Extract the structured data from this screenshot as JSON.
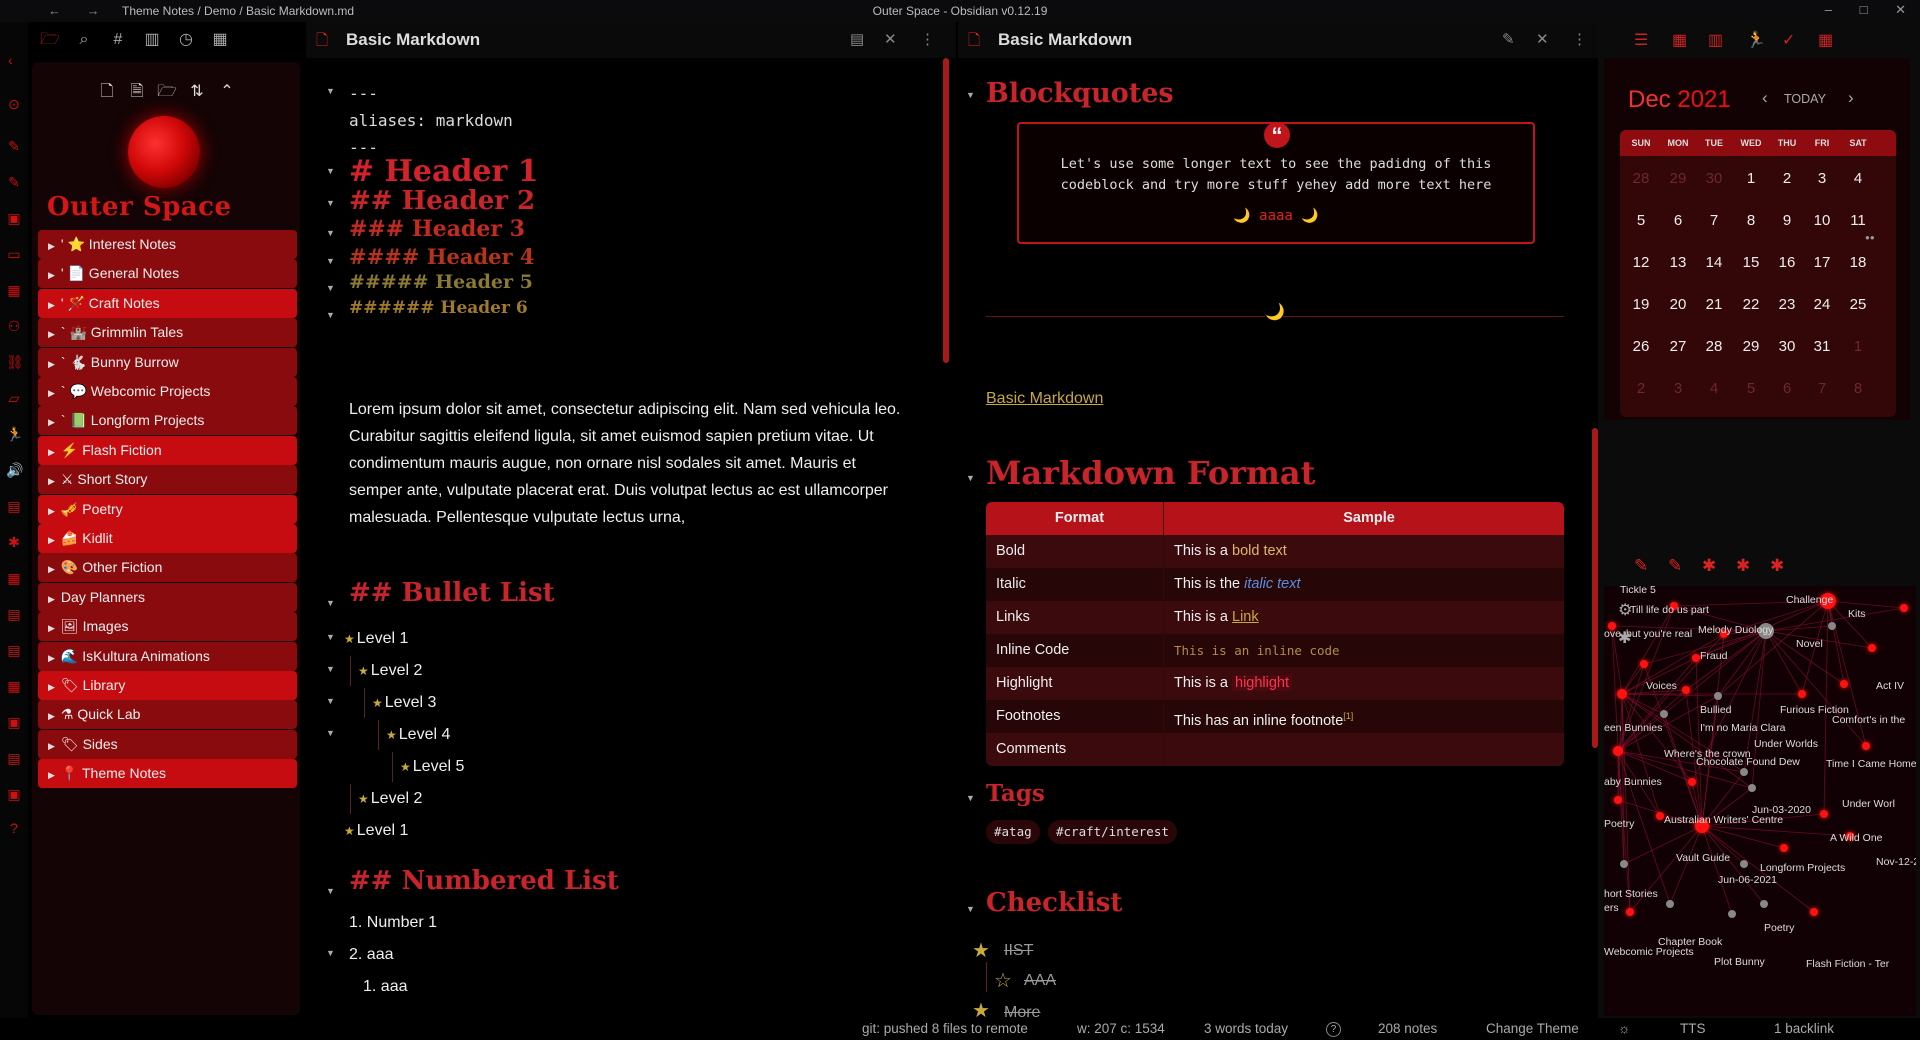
{
  "titlebar": {
    "back": "←",
    "forward": "→",
    "breadcrumb": "Theme Notes / Demo / Basic Markdown.md",
    "app_title": "Outer Space - Obsidian v0.12.19",
    "minimize": "–",
    "maximize": "□",
    "close": "✕"
  },
  "ribbon": {
    "collapse_left": "‹",
    "collapse_right": "›",
    "icons": [
      "⊙",
      "✎",
      "✎",
      "▣",
      "▭",
      "▦",
      "⚇",
      "⛓",
      "▱",
      "🏃",
      "🔊",
      "▤",
      "✱",
      "▦",
      "▤",
      "▤",
      "▦",
      "▣",
      "▤",
      "▣",
      "?"
    ]
  },
  "toptools": {
    "icons": [
      "🗁",
      "⌕",
      "#",
      "▥",
      "◷",
      "▦"
    ]
  },
  "sidebar": {
    "tools": [
      "🗋",
      "🗎",
      "🗁",
      "⇅",
      "⌃"
    ],
    "vault_name": "Outer Space",
    "folders": [
      {
        "arrow": "▶",
        "label": "' ⭐ Interest Notes",
        "bright": false
      },
      {
        "arrow": "▶",
        "label": "' 📄 General Notes",
        "bright": false
      },
      {
        "arrow": "▶",
        "label": "' 🪄 Craft Notes",
        "bright": true
      },
      {
        "arrow": "▶",
        "label": "` 🏰 Grimmlin Tales",
        "bright": false
      },
      {
        "arrow": "▶",
        "label": "` 🐇 Bunny Burrow",
        "bright": false
      },
      {
        "arrow": "▶",
        "label": "` 💬 Webcomic Projects",
        "bright": false
      },
      {
        "arrow": "▶",
        "label": "` 📗 Longform Projects",
        "bright": false
      },
      {
        "arrow": "▶",
        "label": "⚡ Flash Fiction",
        "bright": true
      },
      {
        "arrow": "▶",
        "label": "⚔ Short Story",
        "bright": false
      },
      {
        "arrow": "▶",
        "label": "🎺 Poetry",
        "bright": true
      },
      {
        "arrow": "▶",
        "label": "🍰 Kidlit",
        "bright": true
      },
      {
        "arrow": "▶",
        "label": "🎨 Other Fiction",
        "bright": false
      },
      {
        "arrow": "▶",
        "label": "Day Planners",
        "bright": false
      },
      {
        "arrow": "▶",
        "label": "🖼 Images",
        "bright": false
      },
      {
        "arrow": "▶",
        "label": "🌊 IsKultura Animations",
        "bright": false
      },
      {
        "arrow": "▶",
        "label": "🏷 Library",
        "bright": true
      },
      {
        "arrow": "▶",
        "label": "⚗ Quick Lab",
        "bright": false
      },
      {
        "arrow": "▶",
        "label": "🏷 Sides",
        "bright": false
      },
      {
        "arrow": "▶",
        "label": "📍 Theme Notes",
        "bright": true
      }
    ]
  },
  "pane1": {
    "doc_icon": "🗋",
    "title": "Basic Markdown",
    "actions": [
      "▤",
      "✕",
      "⋮"
    ],
    "frontmatter": [
      "---",
      "aliases: markdown",
      "---"
    ],
    "headers": [
      {
        "text": "# Header 1",
        "color": "#d5222a",
        "size": 30
      },
      {
        "text": "## Header 2",
        "color": "#c8242a",
        "size": 26
      },
      {
        "text": "### Header 3",
        "color": "#c42a20",
        "size": 22
      },
      {
        "text": "#### Header 4",
        "color": "#b7341a",
        "size": 21
      },
      {
        "text": "##### Header 5",
        "color": "#8b7a35",
        "size": 19
      },
      {
        "text": "###### Header 6",
        "color": "#a27a28",
        "size": 17
      }
    ],
    "lorem": "Lorem ipsum dolor sit amet, consectetur adipiscing elit. Nam sed vehicula leo. Curabitur sagittis eleifend ligula, sit amet euismod sapien pretium vitae. Ut condimentum mauris augue, non ornare nisl sodales sit amet. Mauris et semper ante, vulputate placerat erat. Duis volutpat lectus ac est ullamcorper malesuada. Pellentesque vulputate lectus urna,",
    "bullet_heading": "## Bullet List",
    "bullets": [
      "Level 1",
      "Level 2",
      "Level 3",
      "Level 4",
      "Level 5",
      "Level 2",
      "Level 1"
    ],
    "numbered_heading": "## Numbered List",
    "numbered": [
      "1. Number 1",
      "2. aaa",
      "1. aaa"
    ]
  },
  "pane2": {
    "doc_icon": "🗋",
    "title": "Basic Markdown",
    "actions": [
      "✎",
      "✕",
      "⋮"
    ],
    "blockquotes_heading": "Blockquotes",
    "quote_mark": "“",
    "quote_text_1": "Let's use some longer text to see the padidng of this",
    "quote_text_2": "codeblock and try more stuff yehey add more text here",
    "quote_cite": "🌙 aaaa 🌙",
    "hr_moon": "🌙",
    "link": "Basic Markdown",
    "format_heading": "Markdown Format",
    "table_head": [
      "Format",
      "Sample"
    ],
    "table_rows": [
      {
        "format": "Bold",
        "pre": "This is a ",
        "sample": "bold text",
        "post": "",
        "style": "bold"
      },
      {
        "format": "Italic",
        "pre": "This is the ",
        "sample": "italic text",
        "post": "",
        "style": "italic"
      },
      {
        "format": "Links",
        "pre": "This is a ",
        "sample": "Link",
        "post": "",
        "style": "link"
      },
      {
        "format": "Inline Code",
        "pre": "",
        "sample": "This is an inline code",
        "post": "",
        "style": "code"
      },
      {
        "format": "Highlight",
        "pre": "This is a ",
        "sample": "highlight",
        "post": "",
        "style": "highlight"
      },
      {
        "format": "Footnotes",
        "pre": "This has an inline footnote",
        "sample": "[1]",
        "post": "",
        "style": "foot"
      },
      {
        "format": "Comments",
        "pre": "",
        "sample": "",
        "post": "",
        "style": ""
      }
    ],
    "tags_heading": "Tags",
    "tags": [
      "#atag",
      "#craft/interest"
    ],
    "checklist_heading": "Checklist",
    "checklist": [
      "IIST",
      "AAA",
      "More"
    ]
  },
  "right_tools": [
    "☰",
    "▦",
    "▥",
    "🏃",
    "✓",
    "▦"
  ],
  "calendar": {
    "month": "Dec",
    "year": "2021",
    "prev": "‹",
    "today": "TODAY",
    "next": "›",
    "dow": [
      "SUN",
      "MON",
      "TUE",
      "WED",
      "THU",
      "FRI",
      "SAT"
    ],
    "weeks": [
      [
        {
          "d": "28",
          "dim": true
        },
        {
          "d": "29",
          "dim": true
        },
        {
          "d": "30",
          "dim": true
        },
        {
          "d": "1"
        },
        {
          "d": "2"
        },
        {
          "d": "3"
        },
        {
          "d": "4"
        }
      ],
      [
        {
          "d": "5"
        },
        {
          "d": "6"
        },
        {
          "d": "7"
        },
        {
          "d": "8"
        },
        {
          "d": "9"
        },
        {
          "d": "10"
        },
        {
          "d": "11"
        }
      ],
      [
        {
          "d": "12"
        },
        {
          "d": "13"
        },
        {
          "d": "14"
        },
        {
          "d": "15"
        },
        {
          "d": "16"
        },
        {
          "d": "17"
        },
        {
          "d": "18"
        }
      ],
      [
        {
          "d": "19"
        },
        {
          "d": "20"
        },
        {
          "d": "21"
        },
        {
          "d": "22"
        },
        {
          "d": "23"
        },
        {
          "d": "24"
        },
        {
          "d": "25"
        }
      ],
      [
        {
          "d": "26"
        },
        {
          "d": "27"
        },
        {
          "d": "28"
        },
        {
          "d": "29"
        },
        {
          "d": "30"
        },
        {
          "d": "31"
        },
        {
          "d": "1",
          "dim": true
        }
      ],
      [
        {
          "d": "2",
          "dim": true
        },
        {
          "d": "3",
          "dim": true
        },
        {
          "d": "4",
          "dim": true
        },
        {
          "d": "5",
          "dim": true
        },
        {
          "d": "6",
          "dim": true
        },
        {
          "d": "7",
          "dim": true
        },
        {
          "d": "8",
          "dim": true
        }
      ]
    ]
  },
  "graph_tools": [
    "✎",
    "✎",
    "✱",
    "✱",
    "✱"
  ],
  "graph_controls": [
    "⚙",
    "✱"
  ],
  "graph_labels": [
    "Tickle 5",
    "Challenge",
    "Till life do us part",
    "Kits",
    "Novel",
    "Melody Duology",
    "ove",
    "but you're real",
    "Fraud",
    "Voices",
    "Act IV",
    "Bullied",
    "Furious Fiction",
    "Comfort's in the",
    "een Bunnies",
    "I'm no Maria Clara",
    "Under Worlds",
    "Where's the crown",
    "Chocolate Found Dew",
    "Time I Came Home",
    "aby Bunnies",
    "Jun-03-2020",
    "Under Worl",
    "Australian Writers' Centre",
    "Poetry",
    "A Wild One",
    "Vault Guide",
    "Nov-12-2",
    "Jun-06-2021",
    "Longform Projects",
    "hort Stories",
    "ers",
    "Poetry",
    "Webcomic Projects",
    "Chapter Book",
    "Plot Bunny",
    "Flash Fiction - Ter"
  ],
  "status": {
    "git": "git: pushed 8 files to remote",
    "counts": "w: 207 c: 1534",
    "today_words": "3 words today",
    "help": "?",
    "notes": "208 notes",
    "theme": "Change Theme",
    "sun": "☼",
    "tts": "TTS",
    "backlinks": "1 backlink"
  },
  "colors": {
    "accent": "#d41616",
    "panel": "#140405",
    "folder": "#8a0b0d",
    "folder_bright": "#c60c10",
    "gold": "#c9a93b"
  }
}
